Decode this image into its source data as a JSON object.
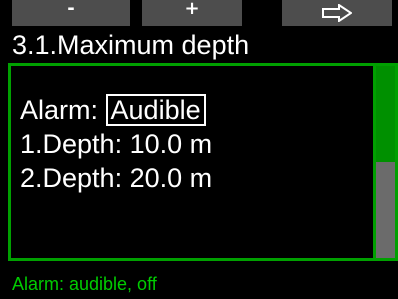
{
  "softkeys": [
    {
      "label": "-",
      "icon": "minus-icon"
    },
    {
      "label": "+",
      "icon": "plus-icon"
    },
    {
      "label": "",
      "icon": "arrow-right-icon"
    }
  ],
  "title": "3.1.Maximum depth",
  "settings": {
    "alarm_label": "Alarm:",
    "alarm_value": "Audible",
    "depth1_label": "1.Depth:",
    "depth1_value": "10.0 m",
    "depth2_label": "2.Depth:",
    "depth2_value": "20.0 m"
  },
  "scroll": {
    "position": 0.5
  },
  "status": "Alarm: audible, off",
  "colors": {
    "accent": "#00a000",
    "status_text": "#00cc00",
    "softkey_bg": "#4d4d4d",
    "background": "#000000"
  }
}
